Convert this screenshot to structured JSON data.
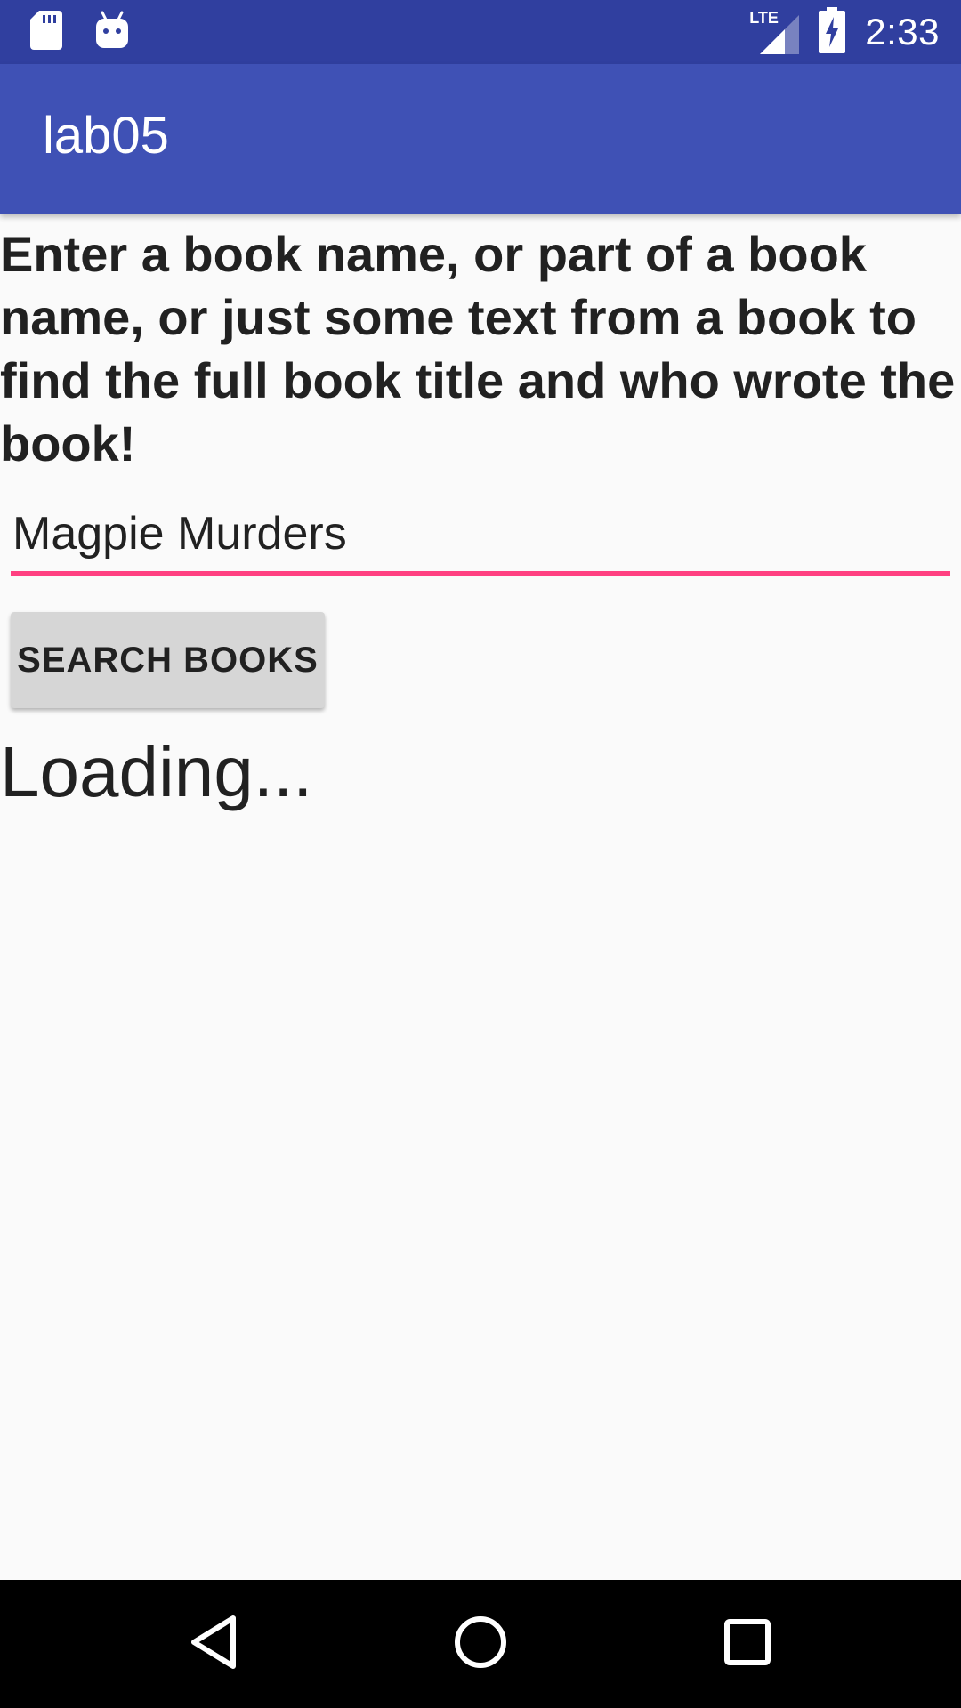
{
  "status_bar": {
    "time": "2:33",
    "network_label": "LTE",
    "icons": [
      "sd-card-icon",
      "android-icon",
      "lte-signal-icon",
      "battery-charging-icon"
    ]
  },
  "app_bar": {
    "title": "lab05"
  },
  "main": {
    "instructions": "Enter a book name, or part of a book name, or just some text from a book to find the full book title and who wrote the book!",
    "search_input": {
      "value": "Magpie Murders"
    },
    "search_button_label": "SEARCH BOOKS",
    "loading_text": "Loading..."
  },
  "navigation_bar": {
    "icons": [
      "back-icon",
      "home-icon",
      "recents-icon"
    ]
  },
  "colors": {
    "status_bar": "#303f9f",
    "app_bar": "#3f51b5",
    "accent": "#ff4081",
    "background": "#fafafa"
  }
}
